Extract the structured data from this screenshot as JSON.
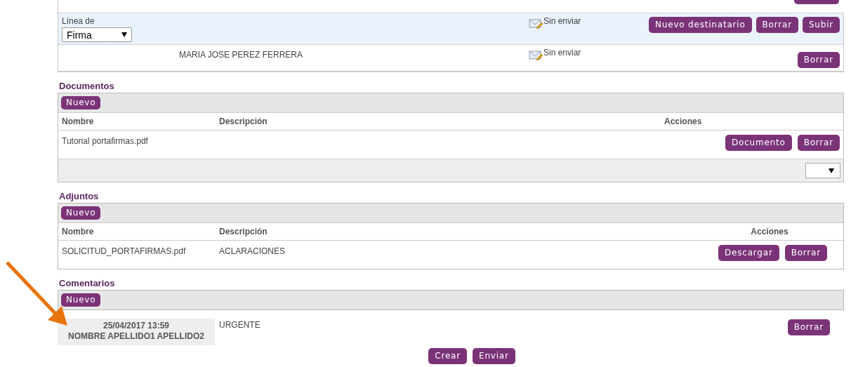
{
  "signers": [
    {
      "kind": "line",
      "highlighted": true,
      "label": "Línea de",
      "select_value": "Firma",
      "status": "Sin enviar",
      "buttons": [
        "Nuevo destinatario",
        "Borrar",
        "Subir"
      ]
    },
    {
      "kind": "recipient",
      "highlighted": false,
      "name": "MARIA JOSE PEREZ FERRERA",
      "status": "Sin enviar",
      "buttons": [
        "Borrar"
      ]
    }
  ],
  "sections": [
    {
      "title": "Documentos",
      "new_button": "Nuevo",
      "columns": [
        "Nombre",
        "Descripción",
        "Acciones"
      ],
      "rows": [
        {
          "cells": [
            "Tutorial portafirmas.pdf",
            ""
          ],
          "buttons": [
            "Documento",
            "Borrar"
          ]
        }
      ],
      "page_select": true
    },
    {
      "title": "Adjuntos",
      "new_button": "Nuevo",
      "columns": [
        "Nombre",
        "Descripción",
        "Acciones"
      ],
      "rows": [
        {
          "cells": [
            "SOLICITUD_PORTAFIRMAS.pdf",
            "ACLARACIONES"
          ],
          "buttons": [
            "Descargar",
            "Borrar"
          ]
        }
      ],
      "page_select": false
    }
  ],
  "comments": {
    "title": "Comentarios",
    "new_button": "Nuevo",
    "items": [
      {
        "date": "25/04/2017 13:59",
        "author": "NOMBRE APELLIDO1 APELLIDO2",
        "text": "URGENTE",
        "buttons": [
          "Borrar"
        ]
      }
    ]
  },
  "footer_buttons": [
    "Crear",
    "Enviar"
  ]
}
